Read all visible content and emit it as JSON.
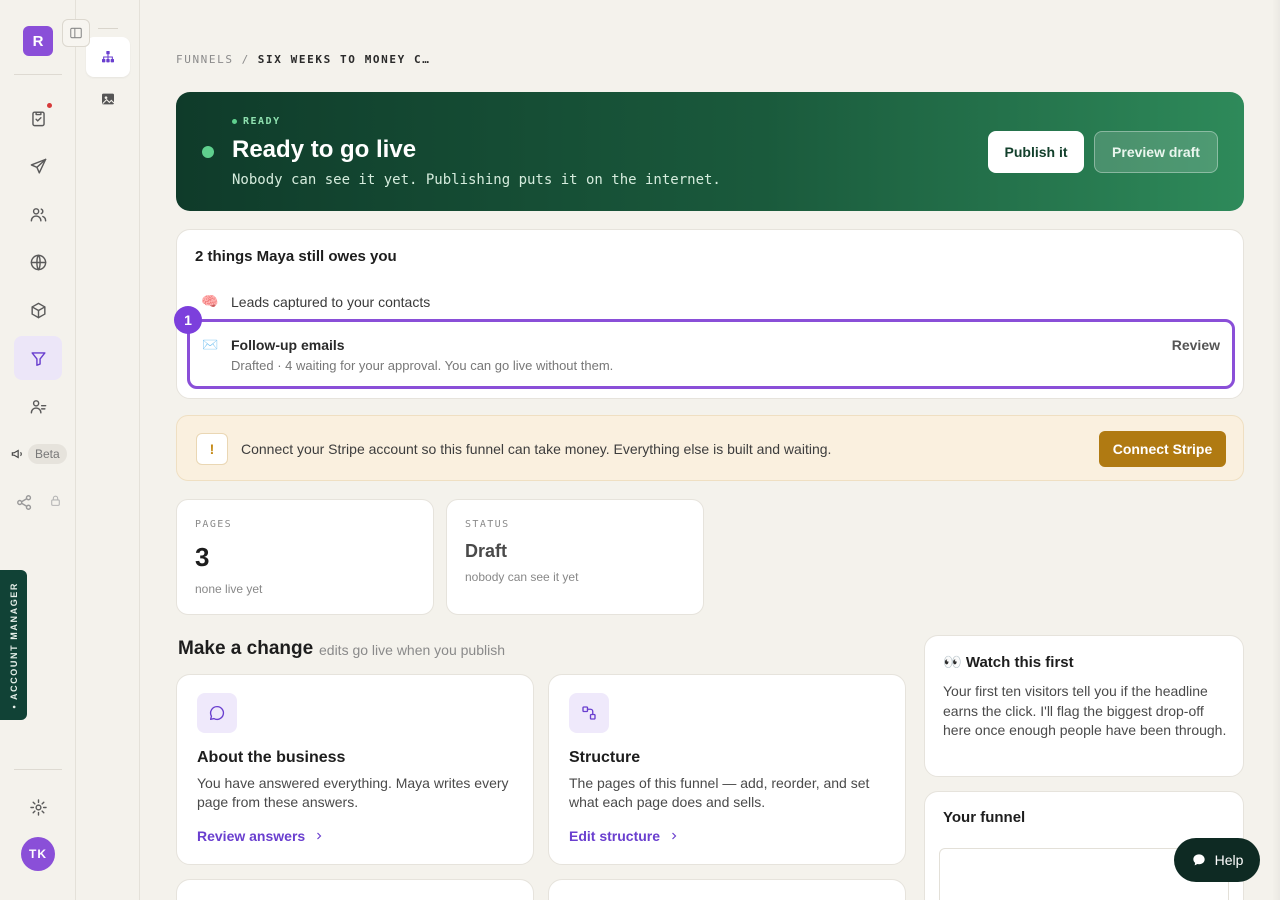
{
  "app": {
    "logo_letter": "R",
    "user_initials": "TK"
  },
  "rail": {
    "beta_label": "Beta",
    "account_manager_label": "• ACCOUNT MANAGER"
  },
  "breadcrumb": {
    "root": "FUNNELS",
    "separator": "/",
    "current": "SIX WEEKS TO MONEY C…"
  },
  "hero": {
    "status_label": "READY",
    "title": "Ready to go live",
    "subtitle": "Nobody can see it yet. Publishing puts it on the internet.",
    "publish_label": "Publish it",
    "preview_label": "Preview draft"
  },
  "owes": {
    "title": "2 things Maya still owes you",
    "items": [
      {
        "icon": "🧠",
        "title": "Leads captured to your contacts"
      },
      {
        "icon": "✉️",
        "title": "Follow-up emails",
        "subtitle": "Drafted · 4 waiting for your approval. You can go live without them.",
        "action": "Review",
        "step": "1"
      }
    ]
  },
  "stripe": {
    "icon": "!",
    "text": "Connect your Stripe account so this funnel can take money. Everything else is built and waiting.",
    "button_label": "Connect Stripe"
  },
  "stats": [
    {
      "label": "PAGES",
      "value": "3",
      "sub": "none live yet"
    },
    {
      "label": "STATUS",
      "value": "Draft",
      "sub": "nobody can see it yet"
    }
  ],
  "change": {
    "title": "Make a change",
    "subtitle": "edits go live when you publish",
    "cards": [
      {
        "title": "About the business",
        "text": "You have answered everything. Maya writes every page from these answers.",
        "link": "Review answers"
      },
      {
        "title": "Structure",
        "text": "The pages of this funnel — add, reorder, and set what each page does and sells.",
        "link": "Edit structure"
      }
    ]
  },
  "watch": {
    "title": "👀 Watch this first",
    "text": "Your first ten visitors tell you if the headline earns the click. I'll flag the biggest drop-off here once enough people have been through."
  },
  "your_funnel": {
    "title": "Your funnel"
  },
  "help": {
    "label": "Help"
  }
}
